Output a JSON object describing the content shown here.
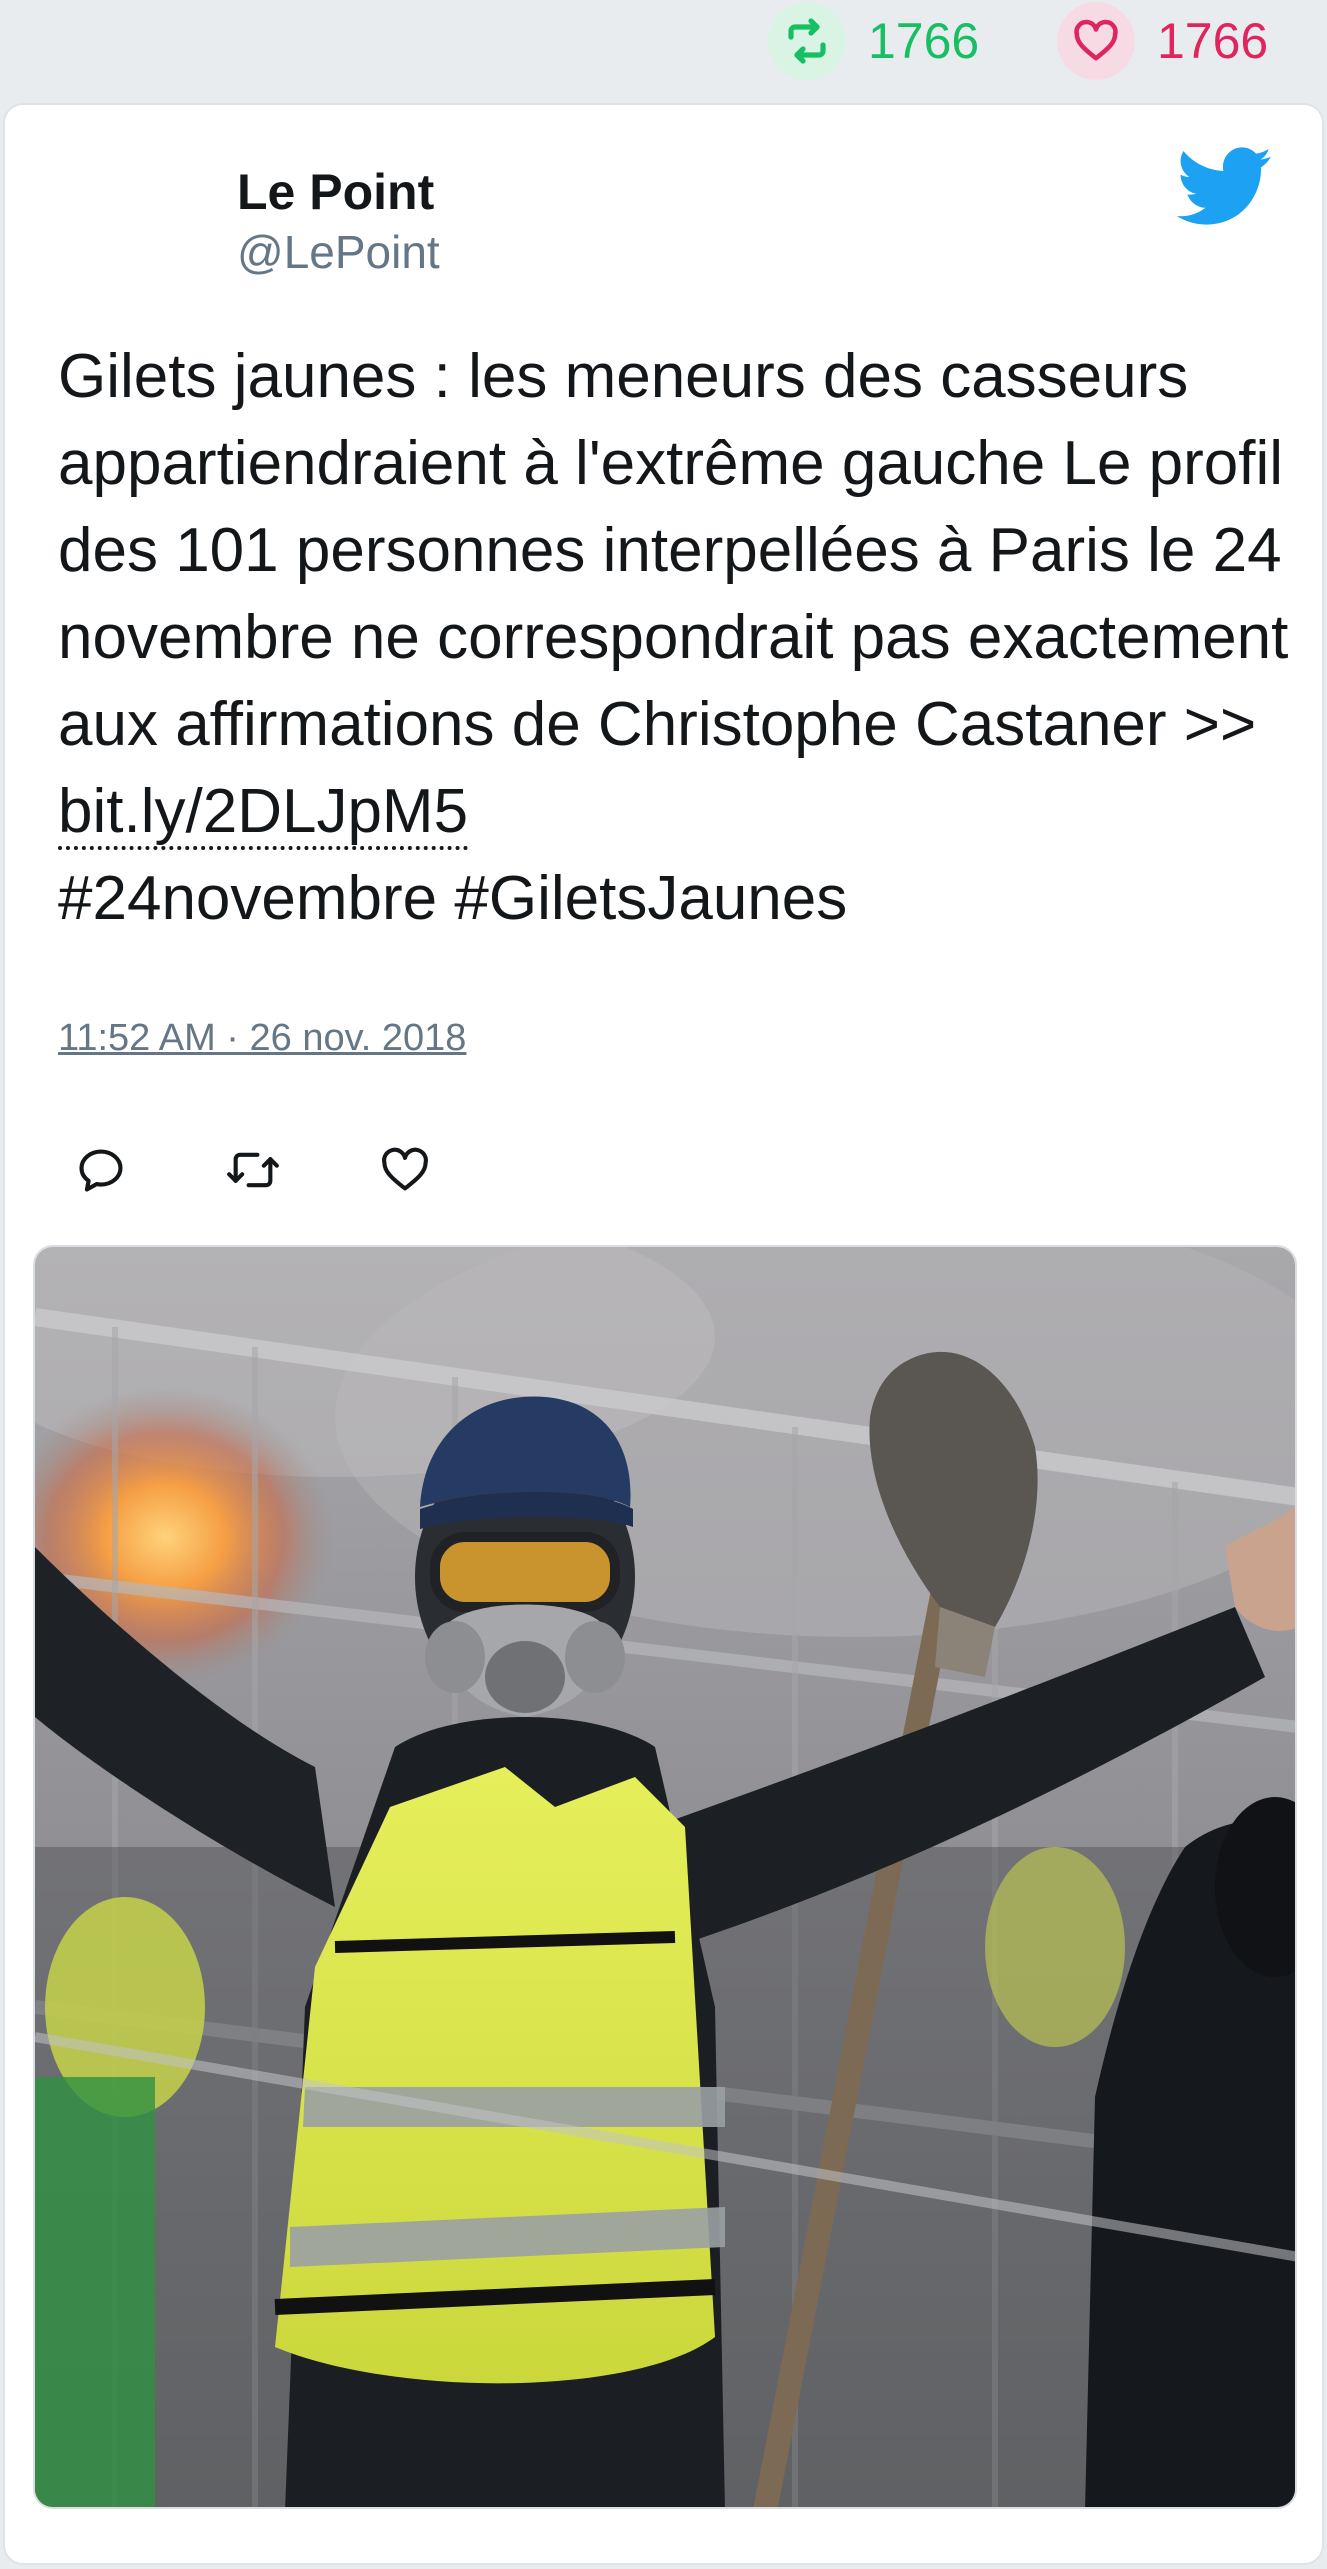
{
  "stats": {
    "retweets": "1766",
    "likes": "1766"
  },
  "tweet": {
    "author_name": "Le Point",
    "author_handle": "@LePoint",
    "text_before_link": "Gilets jaunes : les meneurs des casseurs appartiendraient à l'extrême gauche Le profil des 101 personnes interpellées à Paris le 24 novembre ne correspondrait pas exactement aux affirmations de Christophe Castaner >> ",
    "link": "bit.ly/2DLJpM5",
    "hashtags": "#24novembre #GiletsJaunes",
    "timestamp": "11:52 AM · 26 nov. 2018"
  },
  "icons": {
    "retweet": "retweet-icon",
    "like": "heart-icon",
    "reply": "reply-icon",
    "brand": "twitter-bird-icon"
  },
  "colors": {
    "retweet": "#17bf63",
    "like": "#e0245e",
    "brand": "#1da1f2",
    "muted": "#657786",
    "text": "#14171a"
  }
}
